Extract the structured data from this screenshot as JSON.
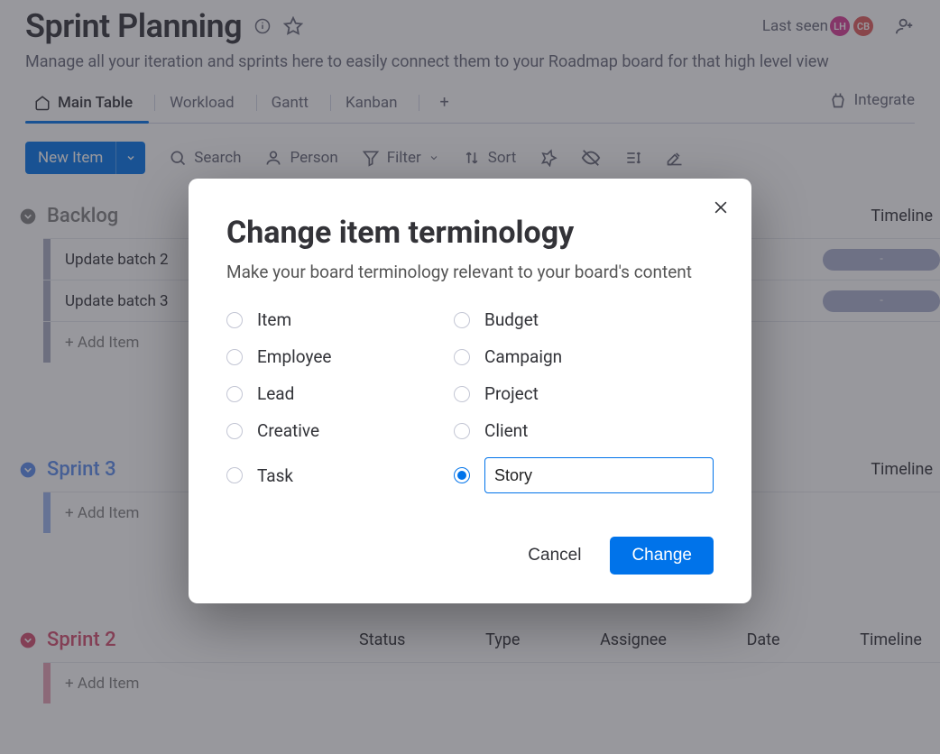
{
  "header": {
    "title": "Sprint Planning",
    "subtitle": "Manage all your iteration and sprints here to easily connect them to your Roadmap board for that high level view",
    "last_seen_label": "Last seen",
    "avatars": [
      "LH",
      "CB"
    ]
  },
  "tabs": {
    "items": [
      "Main Table",
      "Workload",
      "Gantt",
      "Kanban"
    ],
    "active": 0,
    "integrate_label": "Integrate"
  },
  "toolbar": {
    "new_item_label": "New Item",
    "search_label": "Search",
    "person_label": "Person",
    "filter_label": "Filter",
    "sort_label": "Sort"
  },
  "columns": {
    "timeline": "Timeline",
    "status": "Status",
    "type": "Type",
    "assignee": "Assignee",
    "date": "Date"
  },
  "groups": [
    {
      "name": "Backlog",
      "color": "gray",
      "rows": [
        {
          "text": "Update batch 2",
          "pill": "-"
        },
        {
          "text": "Update batch 3",
          "pill": "-"
        }
      ],
      "add_label": "+ Add Item"
    },
    {
      "name": "Sprint 3",
      "color": "blue",
      "rows": [],
      "add_label": "+ Add Item"
    },
    {
      "name": "Sprint 2",
      "color": "red",
      "rows": [],
      "add_label": "+ Add Item"
    }
  ],
  "modal": {
    "title": "Change item terminology",
    "subtitle": "Make your board terminology relevant to your board's content",
    "options_left": [
      "Item",
      "Employee",
      "Lead",
      "Creative",
      "Task"
    ],
    "options_right": [
      "Budget",
      "Campaign",
      "Project",
      "Client"
    ],
    "custom_value": "Story",
    "cancel_label": "Cancel",
    "change_label": "Change"
  }
}
